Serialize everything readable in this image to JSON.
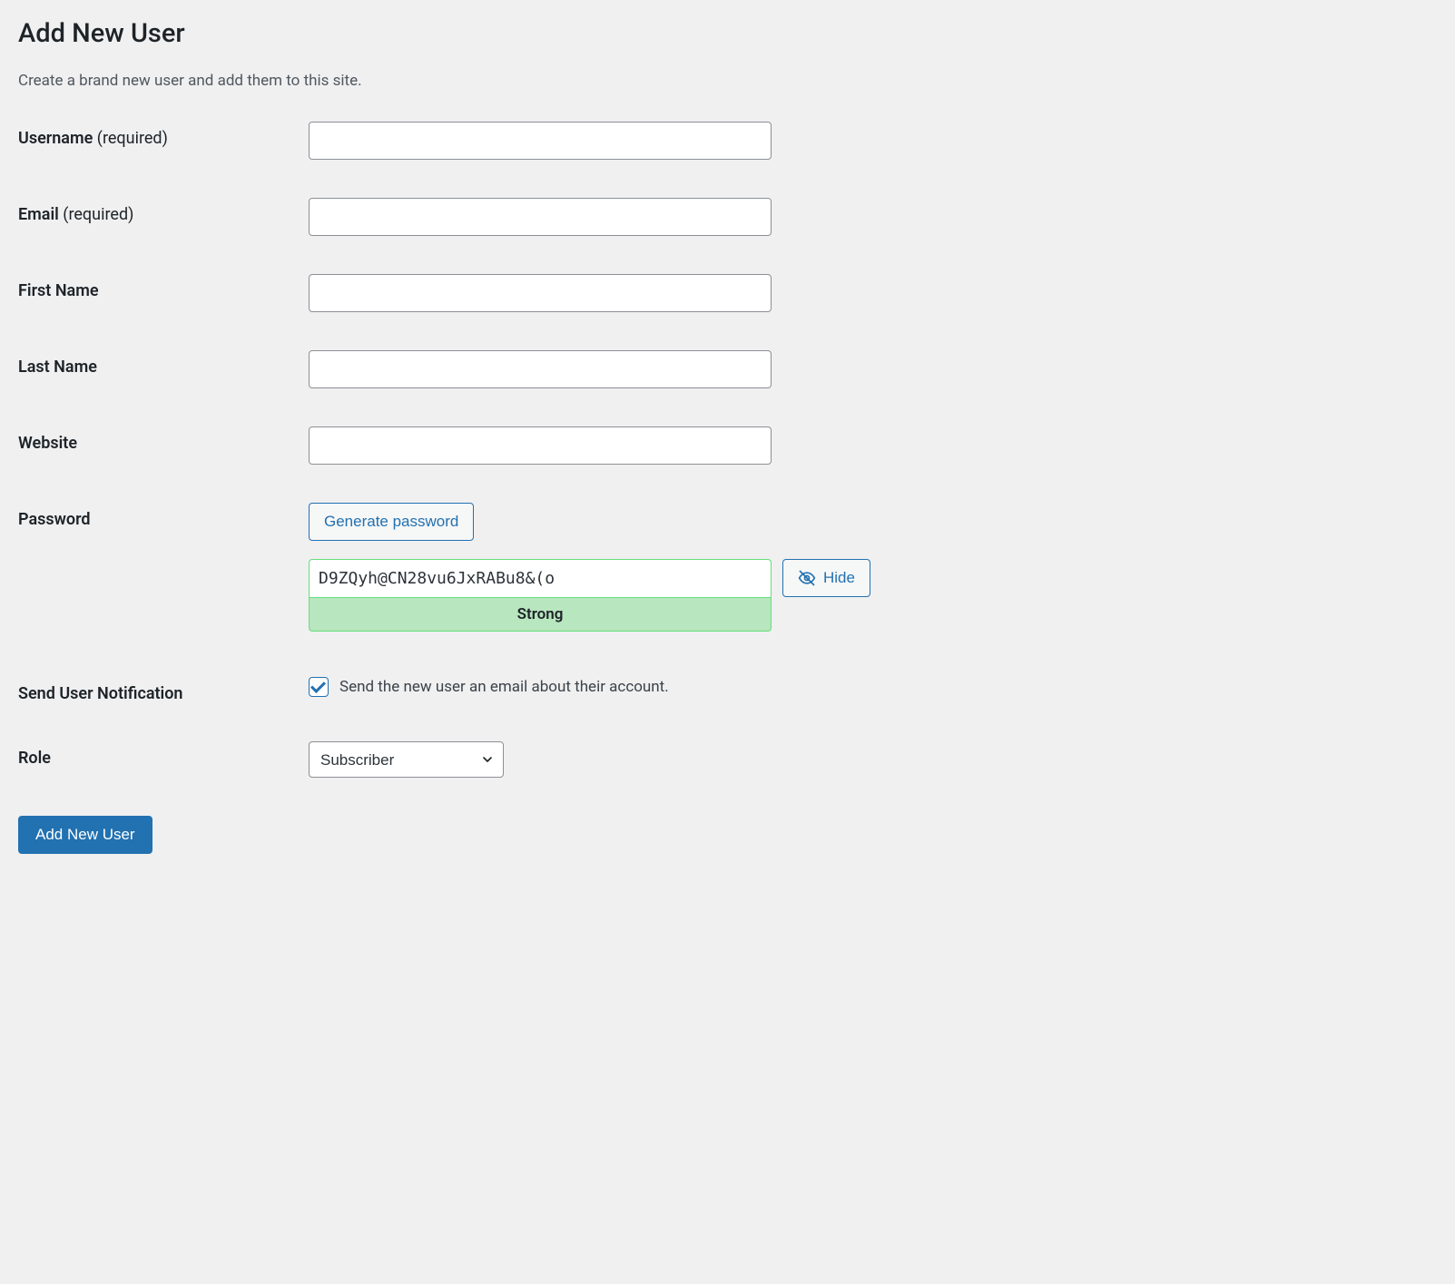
{
  "page": {
    "title": "Add New User",
    "description": "Create a brand new user and add them to this site."
  },
  "form": {
    "username": {
      "label": "Username",
      "required_text": "(required)",
      "value": ""
    },
    "email": {
      "label": "Email",
      "required_text": "(required)",
      "value": ""
    },
    "first_name": {
      "label": "First Name",
      "value": ""
    },
    "last_name": {
      "label": "Last Name",
      "value": ""
    },
    "website": {
      "label": "Website",
      "value": ""
    },
    "password": {
      "label": "Password",
      "generate_button": "Generate password",
      "value": "D9ZQyh@CN28vu6JxRABu8&(o",
      "hide_button": "Hide",
      "strength": "Strong"
    },
    "notification": {
      "label": "Send User Notification",
      "checkbox_label": "Send the new user an email about their account.",
      "checked": true
    },
    "role": {
      "label": "Role",
      "selected": "Subscriber"
    },
    "submit_button": "Add New User"
  }
}
